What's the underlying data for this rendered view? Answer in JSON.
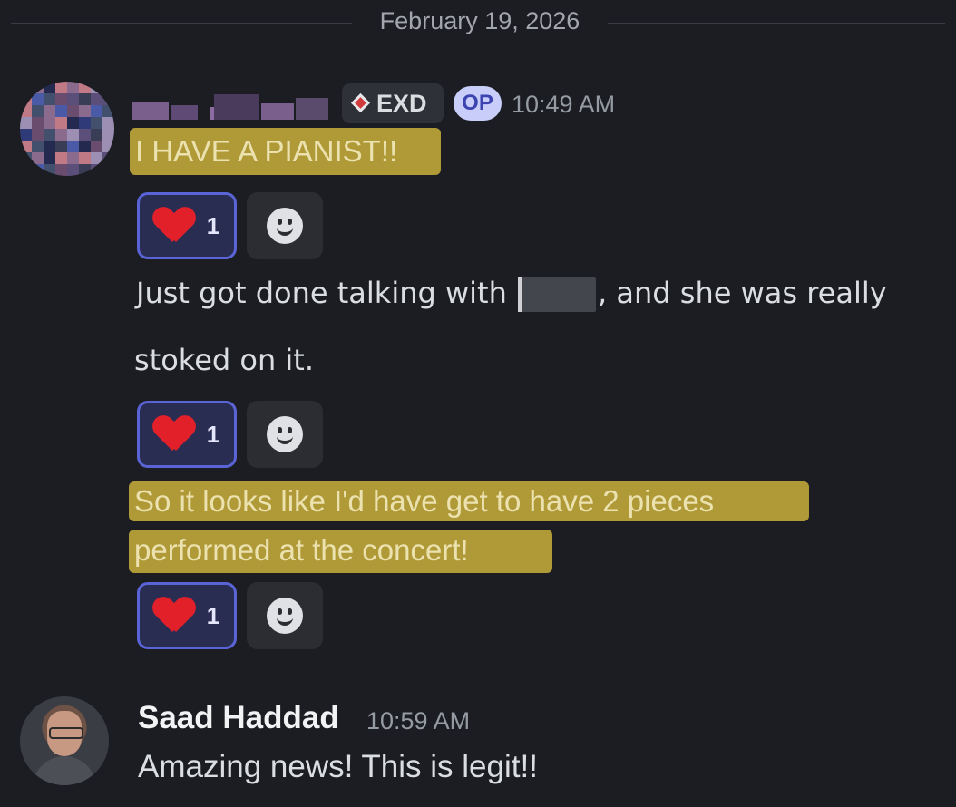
{
  "date_divider": "February 19, 2026",
  "op_message_group": {
    "tag": "EXD",
    "op_badge": "OP",
    "timestamp": "10:49 AM",
    "messages": [
      {
        "text": "I HAVE A PIANIST!!",
        "reaction": {
          "emoji": "heart-emoji",
          "count": "1"
        }
      },
      {
        "text_before": "Just got done talking with",
        "text_after": ", and she was really",
        "text_line2": "stoked on it.",
        "reaction": {
          "emoji": "heart-emoji",
          "count": "1"
        }
      },
      {
        "line1": "So it looks like I'd have get to have 2 pieces",
        "line2": "performed at the concert!",
        "reaction": {
          "emoji": "heart-emoji",
          "count": "1"
        }
      }
    ]
  },
  "reply_group": {
    "author": "Saad Haddad",
    "timestamp": "10:59 AM",
    "text": "Amazing news! This is legit!!"
  },
  "colors": {
    "background": "#1c1d22",
    "highlight": "#b09a37",
    "reaction_border": "#5a64d6",
    "op_badge": "#c8cdf9"
  }
}
